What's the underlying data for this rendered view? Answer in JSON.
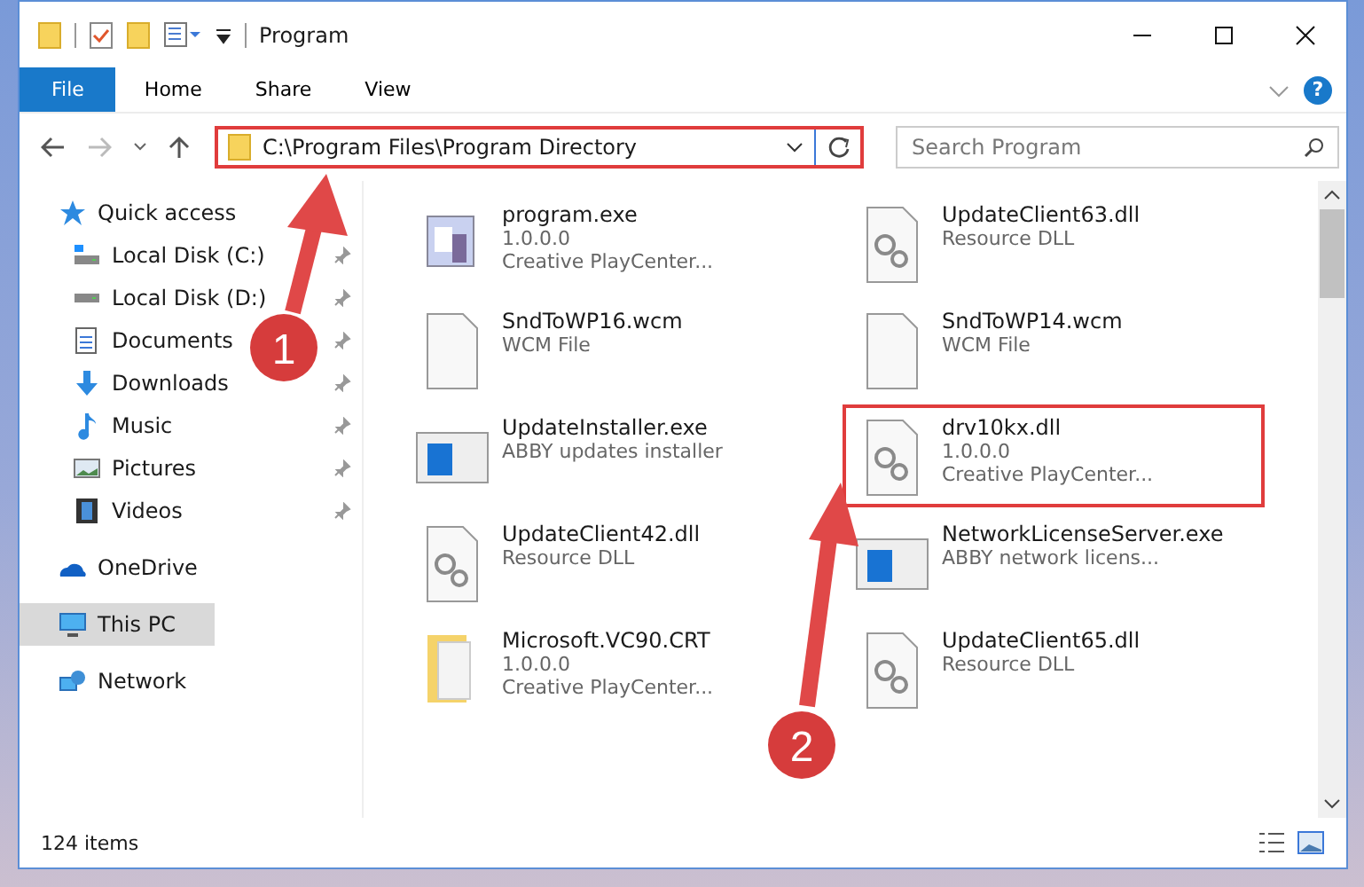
{
  "window": {
    "title": "Program"
  },
  "ribbon": {
    "tabs": [
      {
        "label": "File",
        "selected": true
      },
      {
        "label": "Home",
        "selected": false
      },
      {
        "label": "Share",
        "selected": false
      },
      {
        "label": "View",
        "selected": false
      }
    ],
    "help": "?"
  },
  "address_bar": {
    "path": "C:\\Program Files\\Program Directory",
    "highlighted": true
  },
  "search": {
    "placeholder": "Search Program"
  },
  "sidebar": {
    "items": [
      {
        "label": "Quick access",
        "selected": false,
        "children": [
          {
            "label": "Local Disk (C:)",
            "pinned": true,
            "selected": false
          },
          {
            "label": "Local Disk (D:)",
            "pinned": true,
            "selected": false
          },
          {
            "label": "Documents",
            "pinned": true,
            "selected": false
          },
          {
            "label": "Downloads",
            "pinned": true,
            "selected": false
          },
          {
            "label": "Music",
            "pinned": true,
            "selected": false
          },
          {
            "label": "Pictures",
            "pinned": true,
            "selected": false
          },
          {
            "label": "Videos",
            "pinned": true,
            "selected": false
          }
        ]
      },
      {
        "label": "OneDrive",
        "selected": false
      },
      {
        "label": "This PC",
        "selected": true
      },
      {
        "label": "Network",
        "selected": false
      }
    ]
  },
  "files": [
    {
      "name": "program.exe",
      "kind": "exe",
      "lines": [
        "1.0.0.0",
        "Creative PlayCenter..."
      ],
      "highlighted": false
    },
    {
      "name": "UpdateClient63.dll",
      "kind": "dll",
      "lines": [
        "Resource DLL"
      ],
      "highlighted": false
    },
    {
      "name": "SndToWP16.wcm",
      "kind": "blank",
      "lines": [
        "WCM File"
      ],
      "highlighted": false
    },
    {
      "name": "SndToWP14.wcm",
      "kind": "blank",
      "lines": [
        "WCM File"
      ],
      "highlighted": false
    },
    {
      "name": "UpdateInstaller.exe",
      "kind": "window",
      "lines": [
        "ABBY updates installer"
      ],
      "highlighted": false
    },
    {
      "name": "drv10kx.dll",
      "kind": "dll",
      "lines": [
        "1.0.0.0",
        "Creative PlayCenter..."
      ],
      "highlighted": true
    },
    {
      "name": "UpdateClient42.dll",
      "kind": "dll",
      "lines": [
        "Resource DLL"
      ],
      "highlighted": false
    },
    {
      "name": "NetworkLicenseServer.exe",
      "kind": "window",
      "lines": [
        "ABBY network licens..."
      ],
      "highlighted": false
    },
    {
      "name": "Microsoft.VC90.CRT",
      "kind": "folder",
      "lines": [
        "1.0.0.0",
        "Creative PlayCenter..."
      ],
      "highlighted": false
    },
    {
      "name": "UpdateClient65.dll",
      "kind": "dll",
      "lines": [
        "Resource DLL"
      ],
      "highlighted": false
    }
  ],
  "status_bar": {
    "count": "124 items"
  },
  "callouts": [
    {
      "number": "1"
    },
    {
      "number": "2"
    }
  ]
}
